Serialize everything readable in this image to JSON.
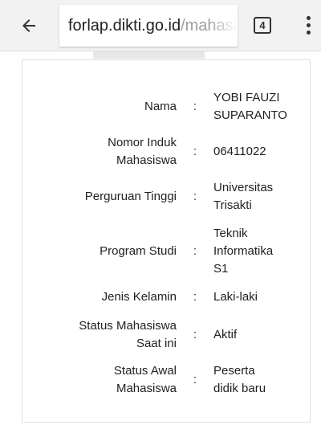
{
  "browser": {
    "url_domain": "forlap.dikti.go.id",
    "url_path": "/mahasiswa",
    "tab_count": "4"
  },
  "icons": {
    "back": "back-arrow-icon",
    "tabs": "tab-switcher-icon",
    "menu": "overflow-menu-icon"
  },
  "student": {
    "separator": ":",
    "fields": [
      {
        "label": [
          "Nama"
        ],
        "value": [
          "YOBI FAUZI",
          "SUPARANTO"
        ]
      },
      {
        "label": [
          "Nomor Induk",
          "Mahasiswa"
        ],
        "value": [
          "06411022"
        ]
      },
      {
        "label": [
          "Perguruan Tinggi"
        ],
        "value": [
          "Universitas",
          "Trisakti"
        ]
      },
      {
        "label": [
          "Program Studi"
        ],
        "value": [
          "Teknik",
          "Informatika",
          "S1"
        ]
      },
      {
        "label": [
          "Jenis Kelamin"
        ],
        "value": [
          "Laki-laki"
        ]
      },
      {
        "label": [
          "Status Mahasiswa",
          "Saat ini"
        ],
        "value": [
          "Aktif"
        ]
      },
      {
        "label": [
          "Status Awal",
          "Mahasiswa"
        ],
        "value": [
          "Peserta",
          "didik baru"
        ]
      }
    ]
  }
}
